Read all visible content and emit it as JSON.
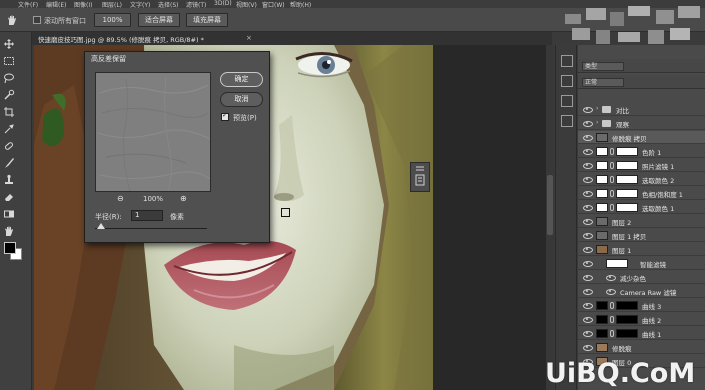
{
  "menubar": {
    "items": [
      "文件(F)",
      "编辑(E)",
      "图像(I)",
      "图层(L)",
      "文字(Y)",
      "选择(S)",
      "滤镜(T)",
      "3D(D)",
      "视图(V)",
      "窗口(W)",
      "帮助(H)"
    ]
  },
  "options_bar": {
    "tool_icon": "hand-tool-icon",
    "scroll_all_label": "滚动所有窗口",
    "btn_100": "100%",
    "btn_fit": "适合屏幕",
    "btn_fill": "填充屏幕"
  },
  "doc_tab": {
    "title": "快速磨皮技巧图.jpg @ 89.5% (修脱痕 拷贝, RGB/8#) *",
    "close": "×"
  },
  "dialog": {
    "title": "高反差保留",
    "ok": "确定",
    "cancel": "取消",
    "preview_label": "预览(P)",
    "preview_checked": true,
    "zoom_level": "100%",
    "zoom_out_icon": "zoom-out-icon",
    "zoom_in_icon": "zoom-in-icon",
    "radius_label": "半径(R):",
    "radius_value": "1",
    "radius_unit": "像素",
    "slider_level": 0.05
  },
  "layers_panel": {
    "kind_filter": "类型",
    "blend_mode": "正常",
    "rows": [
      {
        "name": "对比",
        "type": "group",
        "selected": false
      },
      {
        "name": "观察",
        "type": "group",
        "selected": false
      },
      {
        "name": "修脱痕 拷贝",
        "type": "layer",
        "selected": true
      },
      {
        "name": "色阶 1",
        "type": "adjustment",
        "selected": false
      },
      {
        "name": "照片滤镜 1",
        "type": "adjustment",
        "selected": false
      },
      {
        "name": "选取颜色 2",
        "type": "adjustment",
        "selected": false
      },
      {
        "name": "色相/饱和度 1",
        "type": "adjustment",
        "selected": false
      },
      {
        "name": "选取颜色 1",
        "type": "adjustment",
        "selected": false
      },
      {
        "name": "图层 2",
        "type": "layer",
        "selected": false
      },
      {
        "name": "图层 1 拷贝",
        "type": "layer",
        "selected": false
      },
      {
        "name": "图层 1",
        "type": "smart",
        "selected": false
      },
      {
        "name": "智能滤镜",
        "type": "smartfilter",
        "selected": false
      },
      {
        "name": "减少杂色",
        "type": "filter",
        "selected": false
      },
      {
        "name": "Camera Raw 滤镜",
        "type": "filter",
        "selected": false
      },
      {
        "name": "曲线 3",
        "type": "curves",
        "selected": false
      },
      {
        "name": "曲线 2",
        "type": "curves",
        "selected": false
      },
      {
        "name": "曲线 1",
        "type": "curves",
        "selected": false
      },
      {
        "name": "修脱痕",
        "type": "photo",
        "selected": false
      },
      {
        "name": "图层 0",
        "type": "photo",
        "selected": false
      }
    ]
  },
  "watermark": "UiBQ.CoM",
  "colors": {
    "foreground": "#000000",
    "background": "#ffffff"
  }
}
